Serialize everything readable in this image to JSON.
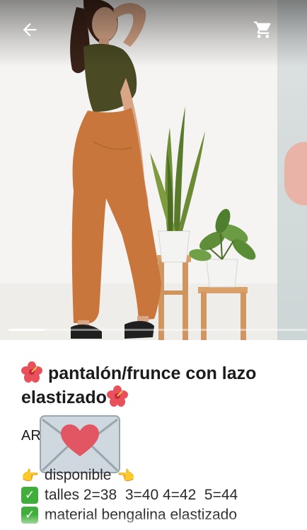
{
  "gallery": {
    "image_alt": "product-photo-orange-pants",
    "progress_fraction": 0.12,
    "current_index": 1
  },
  "header": {
    "back_icon": "arrow-back-icon",
    "cart_icon": "shopping-cart-icon"
  },
  "product": {
    "title_icon": "hibiscus-emoji",
    "title": "pantalón/frunce con lazo elastizado",
    "price_prefix": "AR",
    "price_overlay_icon": "envelope-heart-emoji"
  },
  "description": {
    "availability": {
      "icon_left": "pointing-right-emoji",
      "text": "disponible",
      "icon_right": "pointing-left-emoji"
    },
    "lines": [
      {
        "icon": "check-box-emoji",
        "text": "talles 2=38  3=40 4=42  5=44"
      },
      {
        "icon": "check-box-emoji",
        "text": "material bengalina elastizado"
      }
    ]
  },
  "colors": {
    "accent_check": "#3fae3a",
    "pants": "#c8763b",
    "text": "#1b1b1b"
  }
}
